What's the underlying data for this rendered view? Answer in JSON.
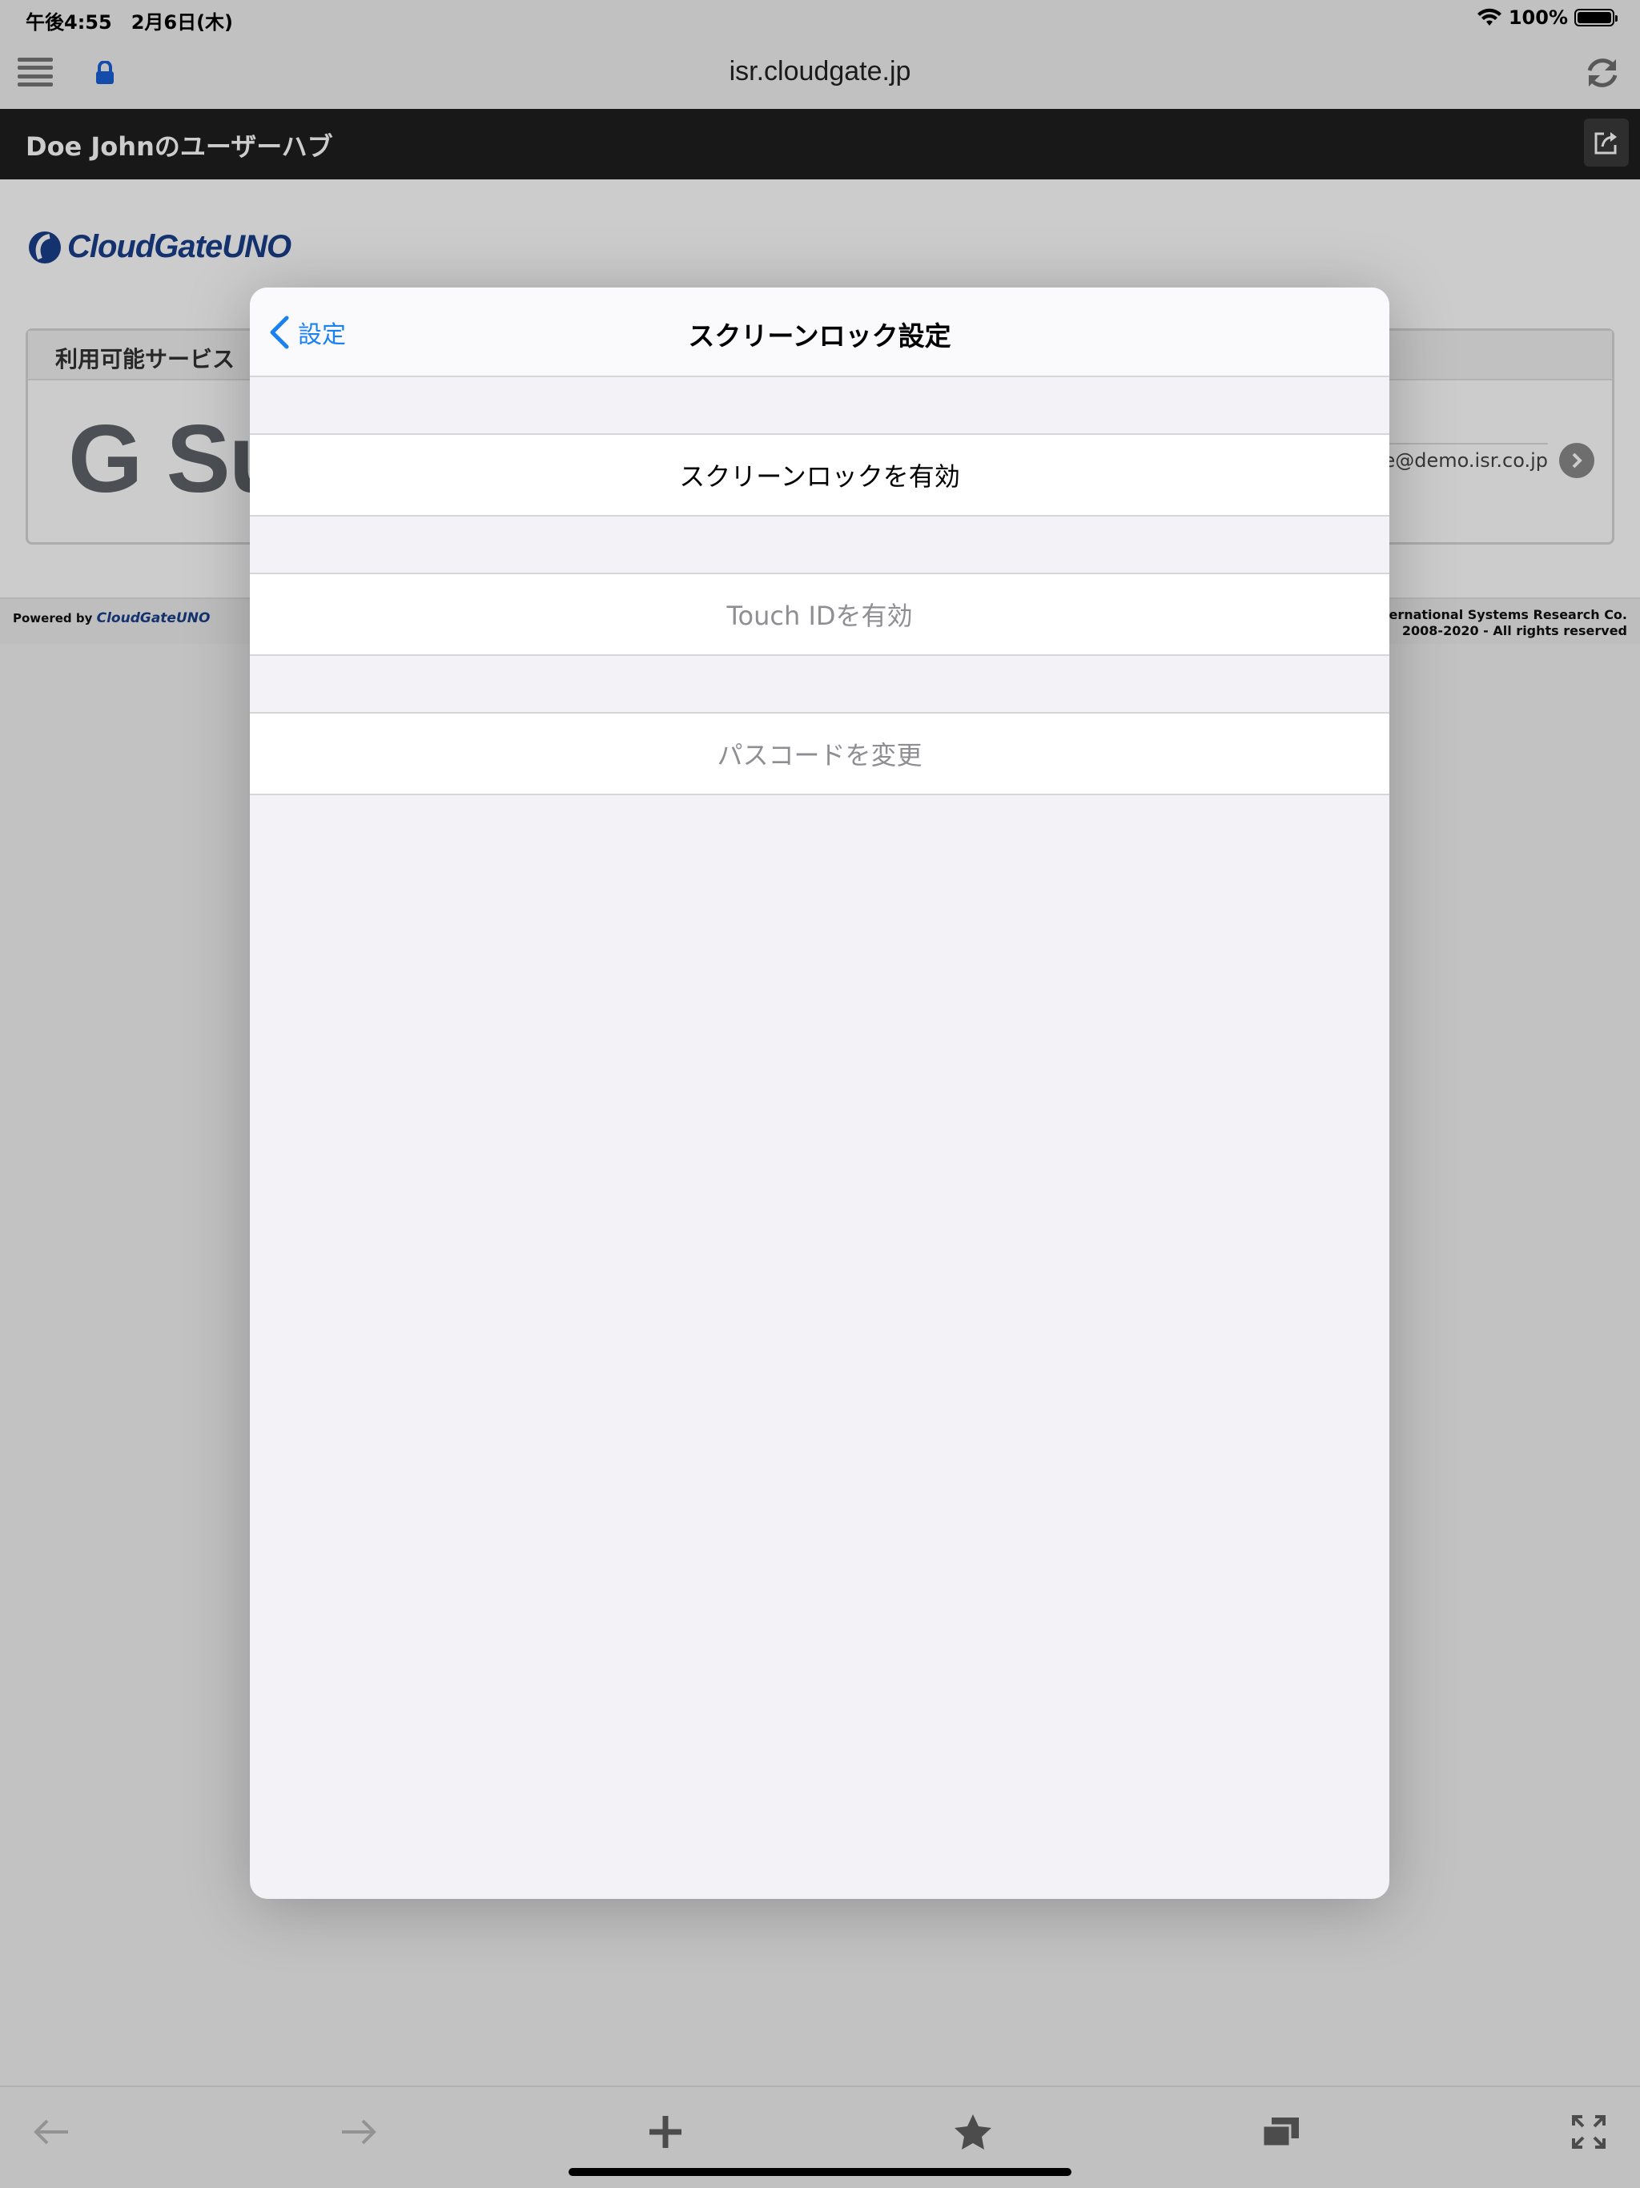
{
  "status_bar": {
    "time": "午後4:55　2月6日(木)",
    "battery": "100%"
  },
  "browser": {
    "url": "isr.cloudgate.jp"
  },
  "hub": {
    "title": "Doe Johnのユーザーハブ"
  },
  "logo": {
    "text_light": "CloudGate",
    "text_bold": "UNO"
  },
  "services": {
    "header": "利用可能サービス",
    "items": [
      {
        "name": "G Su",
        "account": "oe@demo.isr.co.jp"
      }
    ]
  },
  "footer": {
    "powered_by": "Powered by",
    "powered_logo": "CloudGateUNO",
    "copyright_line1": "© International Systems Research Co.",
    "copyright_line2": "2008-2020 - All rights reserved"
  },
  "modal": {
    "back_label": "設定",
    "title": "スクリーンロック設定",
    "rows": [
      {
        "label": "スクリーンロックを有効",
        "enabled": true
      },
      {
        "label": "Touch IDを有効",
        "enabled": false
      },
      {
        "label": "パスコードを変更",
        "enabled": false
      }
    ]
  },
  "icons": {
    "menu": "hamburger-icon",
    "lock": "lock-icon",
    "refresh": "refresh-icon",
    "share": "share-icon",
    "back": "chevron-left-icon",
    "forward": "arrow-right-icon",
    "add": "plus-icon",
    "bookmark": "star-icon",
    "tabs": "tabs-icon",
    "fullscreen": "fullscreen-icon"
  },
  "colors": {
    "accent": "#1a82f0",
    "hub_bar": "#1f1f1f",
    "disabled_text": "#8e8e93"
  }
}
